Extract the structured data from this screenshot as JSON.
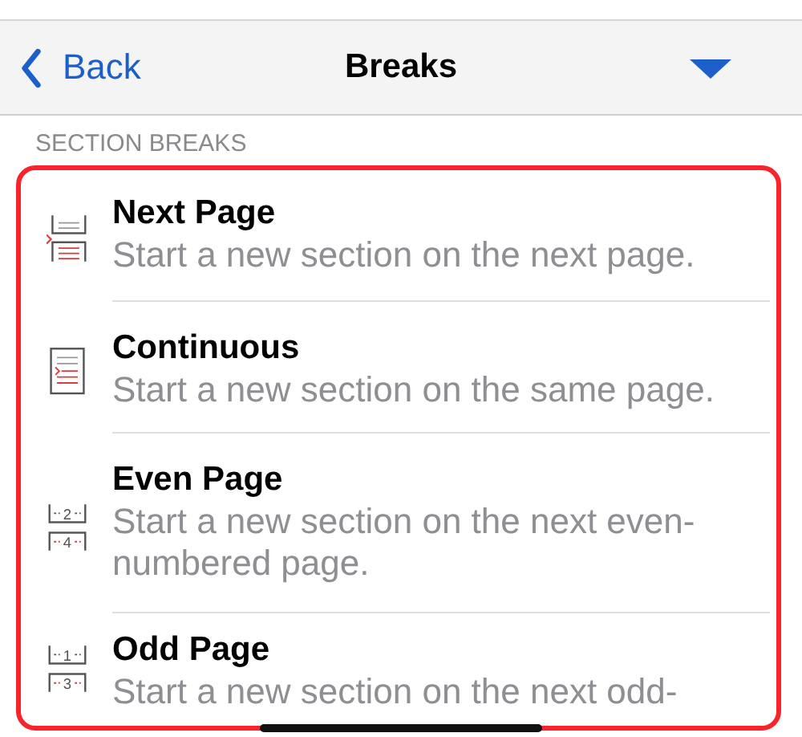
{
  "nav": {
    "back": "Back",
    "title": "Breaks"
  },
  "section_header": "SECTION BREAKS",
  "items": [
    {
      "kind": "next_page",
      "title": "Next Page",
      "subtitle": "Start a new section on the next page."
    },
    {
      "kind": "continuous",
      "title": "Continuous",
      "subtitle": "Start a new section on the same page."
    },
    {
      "kind": "even_page",
      "title": "Even Page",
      "subtitle": "Start a new section on the next even-numbered page.",
      "page_numbers": [
        "2",
        "4"
      ]
    },
    {
      "kind": "odd_page",
      "title": "Odd Page",
      "subtitle": "Start a new section on the next odd-",
      "page_numbers": [
        "1",
        "3"
      ]
    }
  ]
}
